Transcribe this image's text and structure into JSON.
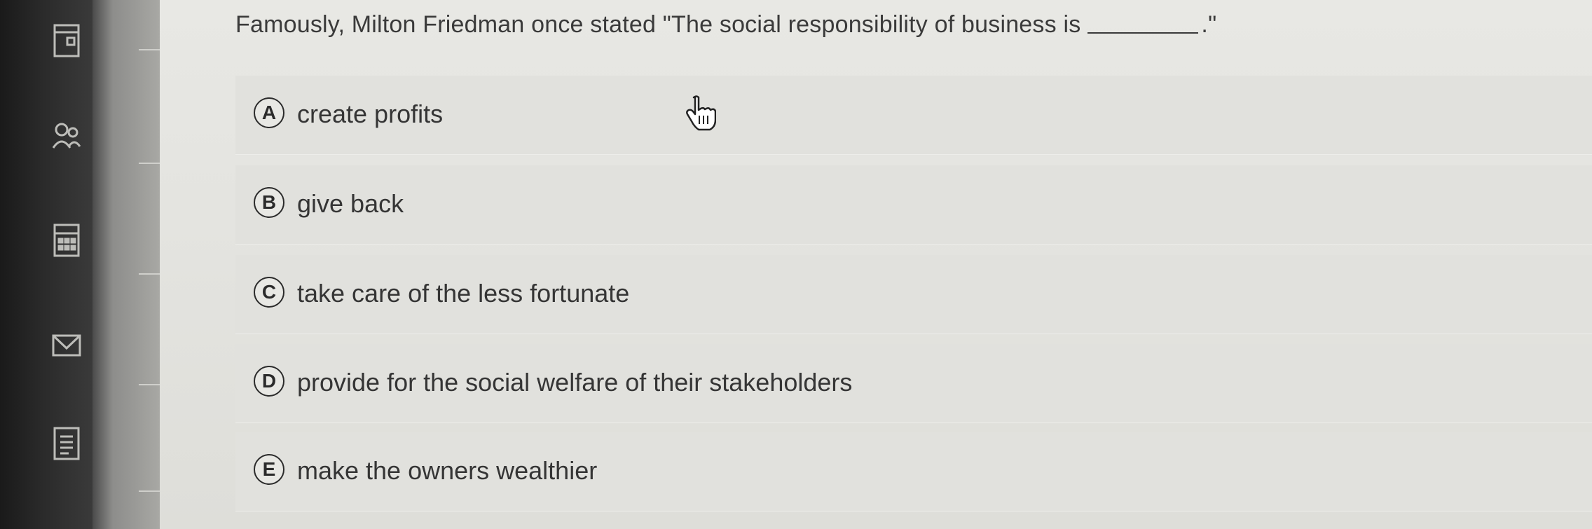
{
  "question": {
    "text": "Famously, Milton Friedman once stated \"The social responsibility of business is",
    "end": ".\""
  },
  "options": [
    {
      "letter": "A",
      "text": "create profits"
    },
    {
      "letter": "B",
      "text": "give back"
    },
    {
      "letter": "C",
      "text": "take care of the less fortunate"
    },
    {
      "letter": "D",
      "text": "provide for the social welfare of their stakeholders"
    },
    {
      "letter": "E",
      "text": "make the owners wealthier"
    }
  ],
  "sidebar": {
    "icons": [
      "document-icon",
      "people-icon",
      "calculator-icon",
      "mail-icon",
      "notes-icon"
    ]
  },
  "cursor": "hand-pointer-icon"
}
